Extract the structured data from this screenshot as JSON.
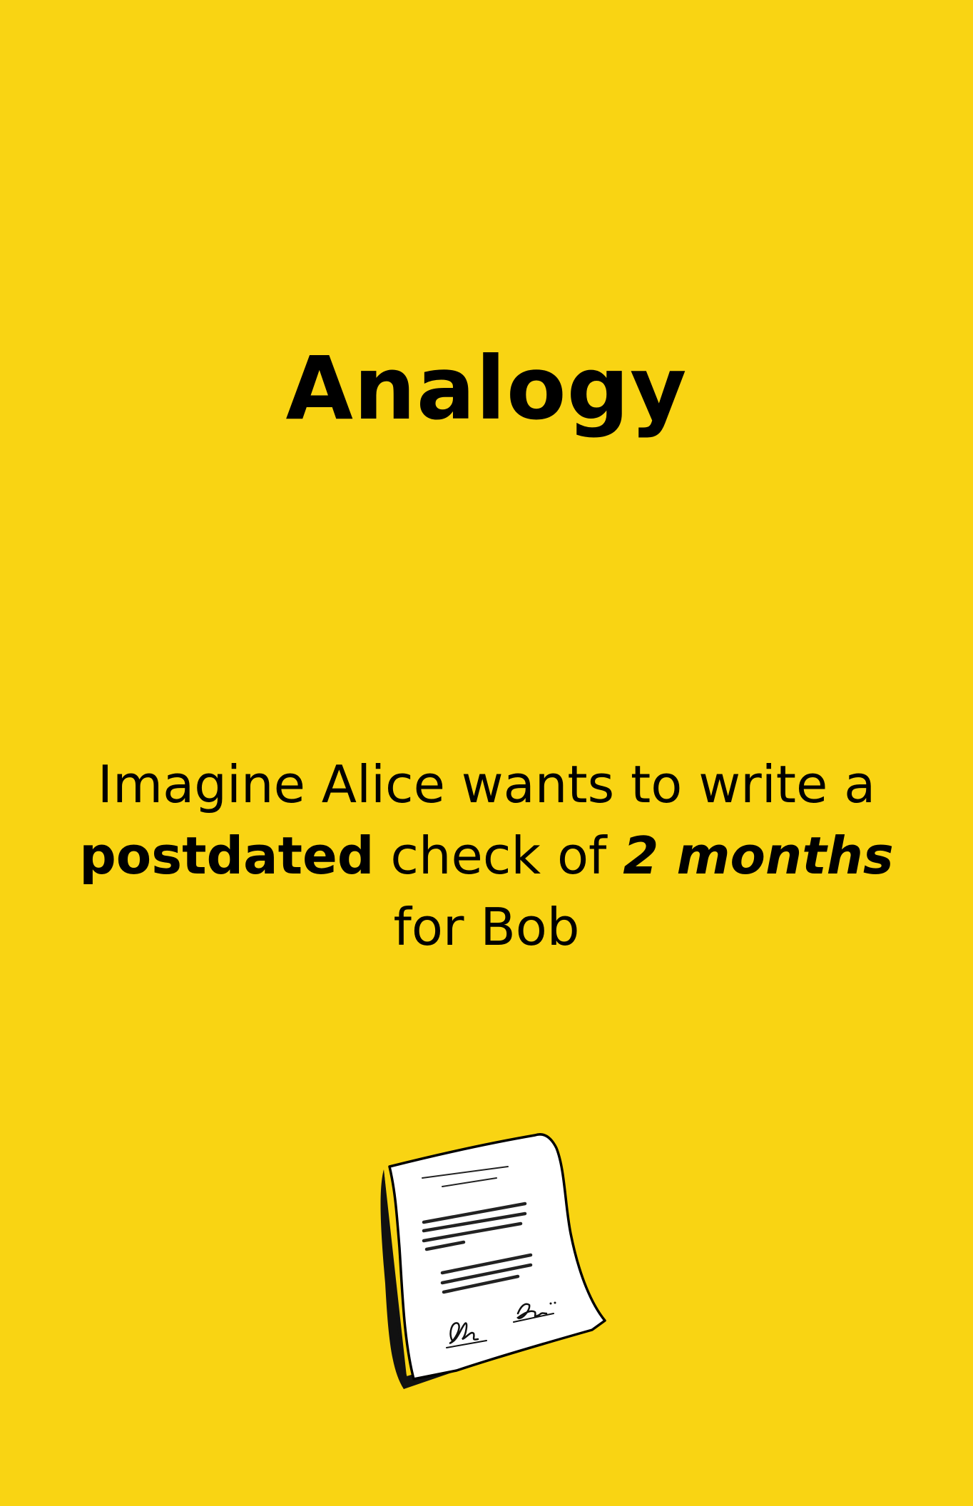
{
  "slide": {
    "title": "Analogy",
    "sentence": {
      "line1": "Imagine Alice wants to write a",
      "bold_word": "postdated",
      "middle": " check of ",
      "emphasis": "2 months",
      "line3": "for Bob"
    },
    "illustration_icon": "signed-document-icon"
  },
  "colors": {
    "background": "#f9d413",
    "text": "#000000",
    "paper": "#ffffff"
  }
}
